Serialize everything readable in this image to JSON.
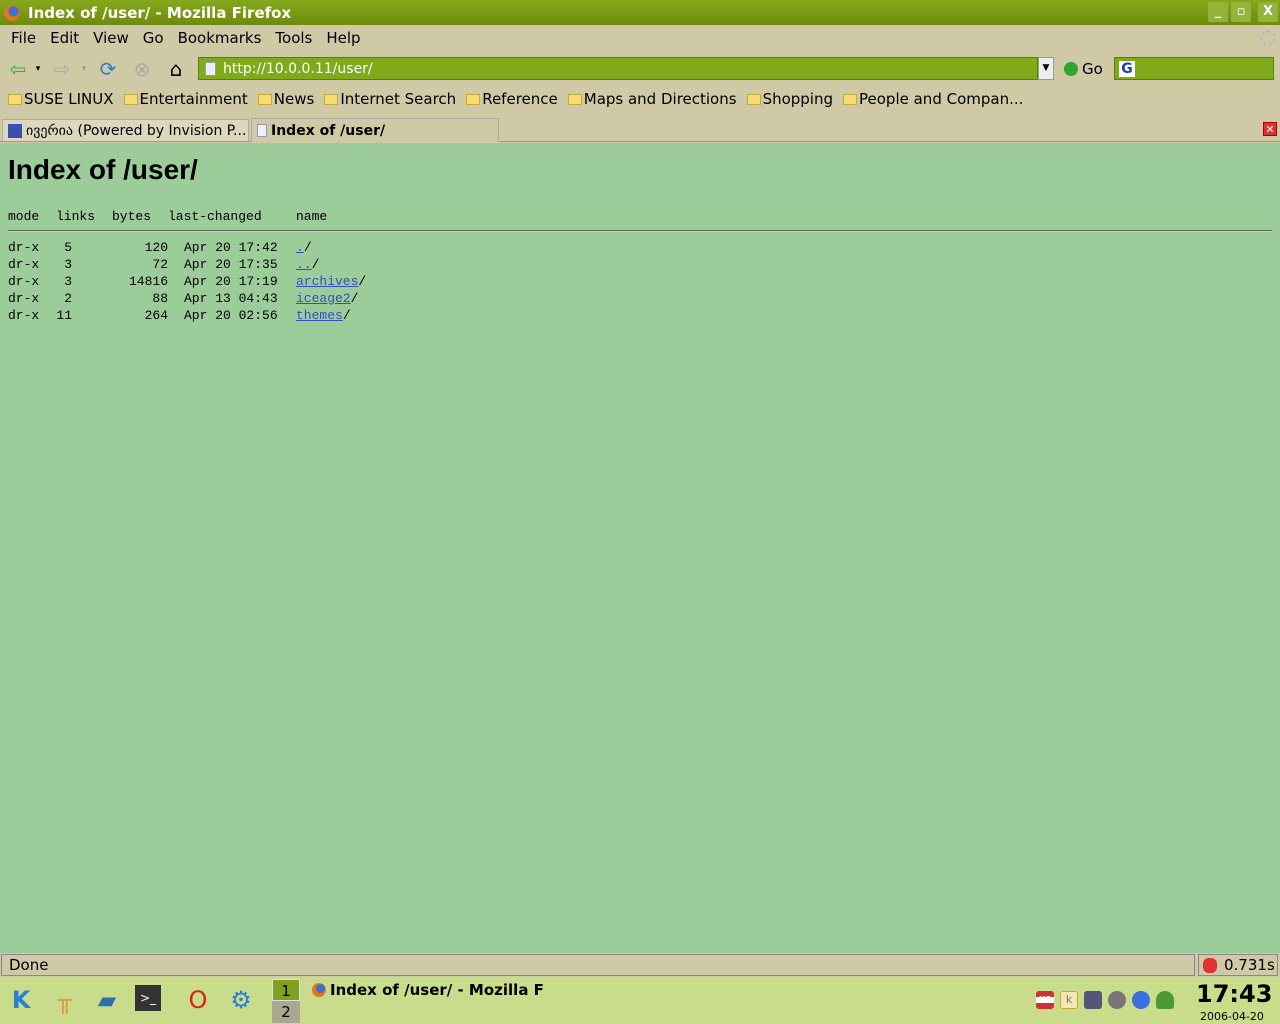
{
  "window": {
    "title": "Index of /user/ - Mozilla Firefox",
    "minimize": "_",
    "restore": "▫",
    "close": "X"
  },
  "menu": [
    "File",
    "Edit",
    "View",
    "Go",
    "Bookmarks",
    "Tools",
    "Help"
  ],
  "nav": {
    "url": "http://10.0.0.11/user/",
    "go_label": "Go",
    "search_engine": "G"
  },
  "bookmarks": [
    "SUSE LINUX",
    "Entertainment",
    "News",
    "Internet Search",
    "Reference",
    "Maps and Directions",
    "Shopping",
    "People and Compan..."
  ],
  "tabs": [
    {
      "label": "ივერია (Powered by Invision P..."
    },
    {
      "label": "Index of /user/"
    }
  ],
  "page": {
    "heading": "Index of /user/",
    "columns": [
      "mode",
      "links",
      "bytes",
      "last-changed",
      "name"
    ],
    "rows": [
      {
        "mode": "dr-x",
        "links": "5",
        "bytes": "120",
        "changed": "Apr 20 17:42",
        "name": ".",
        "suffix": "/"
      },
      {
        "mode": "dr-x",
        "links": "3",
        "bytes": "72",
        "changed": "Apr 20 17:35",
        "name": "..",
        "suffix": "/"
      },
      {
        "mode": "dr-x",
        "links": "3",
        "bytes": "14816",
        "changed": "Apr 20 17:19",
        "name": "archives",
        "suffix": "/"
      },
      {
        "mode": "dr-x",
        "links": "2",
        "bytes": "88",
        "changed": "Apr 13 04:43",
        "name": "iceage2",
        "suffix": "/"
      },
      {
        "mode": "dr-x",
        "links": "11",
        "bytes": "264",
        "changed": "Apr 20 02:56",
        "name": "themes",
        "suffix": "/"
      }
    ]
  },
  "status": {
    "text": "Done",
    "timing": "0.731s"
  },
  "taskbar": {
    "pager": [
      "1",
      "2"
    ],
    "task": "Index of /user/ - Mozilla F",
    "clock": "17:43",
    "date": "2006-04-20",
    "keyboard": "US",
    "klipper": "k"
  }
}
